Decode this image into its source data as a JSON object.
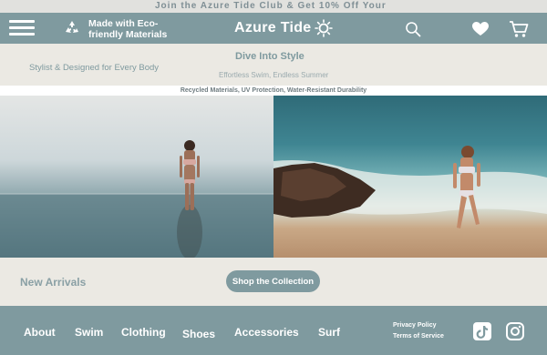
{
  "banner": {
    "text": "Join the Azure Tide Club & Get 10% Off Your"
  },
  "header": {
    "eco_text": "Made with Eco-friendly Materials",
    "brand": "Azure Tide"
  },
  "tagline": {
    "left": "Stylist & Designed for Every Body",
    "title": "Dive Into Style",
    "subtitle": "Effortless Swim, Endless Summer"
  },
  "features": {
    "text": "Recycled Materials, UV Protection, Water-Resistant Durability"
  },
  "arrivals": {
    "title": "New Arrivals",
    "button": "Shop the Collection"
  },
  "footer": {
    "nav": [
      "About",
      "Swim",
      "Clothing",
      "Shoes",
      "Accessories",
      "Surf"
    ],
    "privacy": "Privacy Policy",
    "terms": "Terms of Service"
  },
  "colors": {
    "accent": "#7f9a9f",
    "background": "#ebe9e3"
  },
  "icons": [
    "menu-icon",
    "recycle-icon",
    "sun-icon",
    "search-icon",
    "heart-icon",
    "cart-icon",
    "tiktok-icon",
    "instagram-icon"
  ]
}
